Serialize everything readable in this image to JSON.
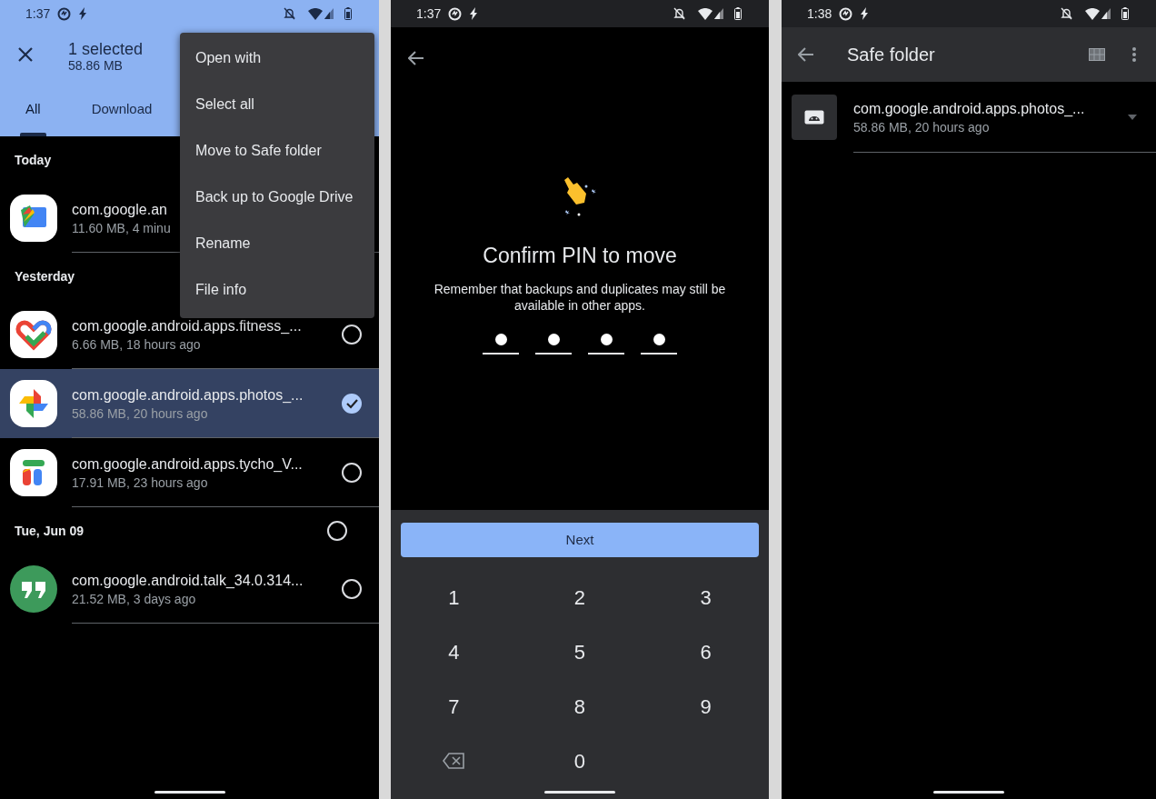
{
  "screens": [
    {
      "status_bar": {
        "time": "1:37"
      },
      "header": {
        "title": "1 selected",
        "subtitle": "58.86 MB"
      },
      "tabs": [
        {
          "label": "All",
          "selected": true
        },
        {
          "label": "Download",
          "selected": false
        }
      ],
      "menu": [
        "Open with",
        "Select all",
        "Move to Safe folder",
        "Back up to Google Drive",
        "Rename",
        "File info"
      ],
      "groups": [
        {
          "label": "Today",
          "items": [
            {
              "name": "com.google.an",
              "meta": "11.60 MB, 4 minu"
            }
          ]
        },
        {
          "label": "Yesterday",
          "items": [
            {
              "name": "com.google.android.apps.fitness_...",
              "meta": "6.66 MB, 18 hours ago",
              "selected": false
            },
            {
              "name": "com.google.android.apps.photos_...",
              "meta": "58.86 MB, 20 hours ago",
              "selected": true
            },
            {
              "name": "com.google.android.apps.tycho_V...",
              "meta": "17.91 MB, 23 hours ago",
              "selected": false
            }
          ]
        },
        {
          "label": "Tue, Jun 09",
          "selected": false,
          "items": [
            {
              "name": "com.google.android.talk_34.0.314...",
              "meta": "21.52 MB, 3 days ago",
              "selected": false
            }
          ]
        }
      ]
    },
    {
      "status_bar": {
        "time": "1:37"
      },
      "title": "Confirm PIN to move",
      "message": "Remember that backups and duplicates may still be available in other apps.",
      "pin": [
        {
          "filled": true
        },
        {
          "filled": true
        },
        {
          "filled": true
        },
        {
          "filled": true
        }
      ],
      "button": "Next",
      "keypad": [
        {
          "kind": "digit",
          "label": "1"
        },
        {
          "kind": "digit",
          "label": "2"
        },
        {
          "kind": "digit",
          "label": "3"
        },
        {
          "kind": "digit",
          "label": "4"
        },
        {
          "kind": "digit",
          "label": "5"
        },
        {
          "kind": "digit",
          "label": "6"
        },
        {
          "kind": "digit",
          "label": "7"
        },
        {
          "kind": "digit",
          "label": "8"
        },
        {
          "kind": "digit",
          "label": "9"
        },
        {
          "kind": "backspace"
        },
        {
          "kind": "digit",
          "label": "0"
        }
      ]
    },
    {
      "status_bar": {
        "time": "1:38"
      },
      "title": "Safe folder",
      "files": [
        {
          "name": "com.google.android.apps.photos_...",
          "meta": "58.86 MB, 20 hours ago"
        }
      ]
    }
  ]
}
